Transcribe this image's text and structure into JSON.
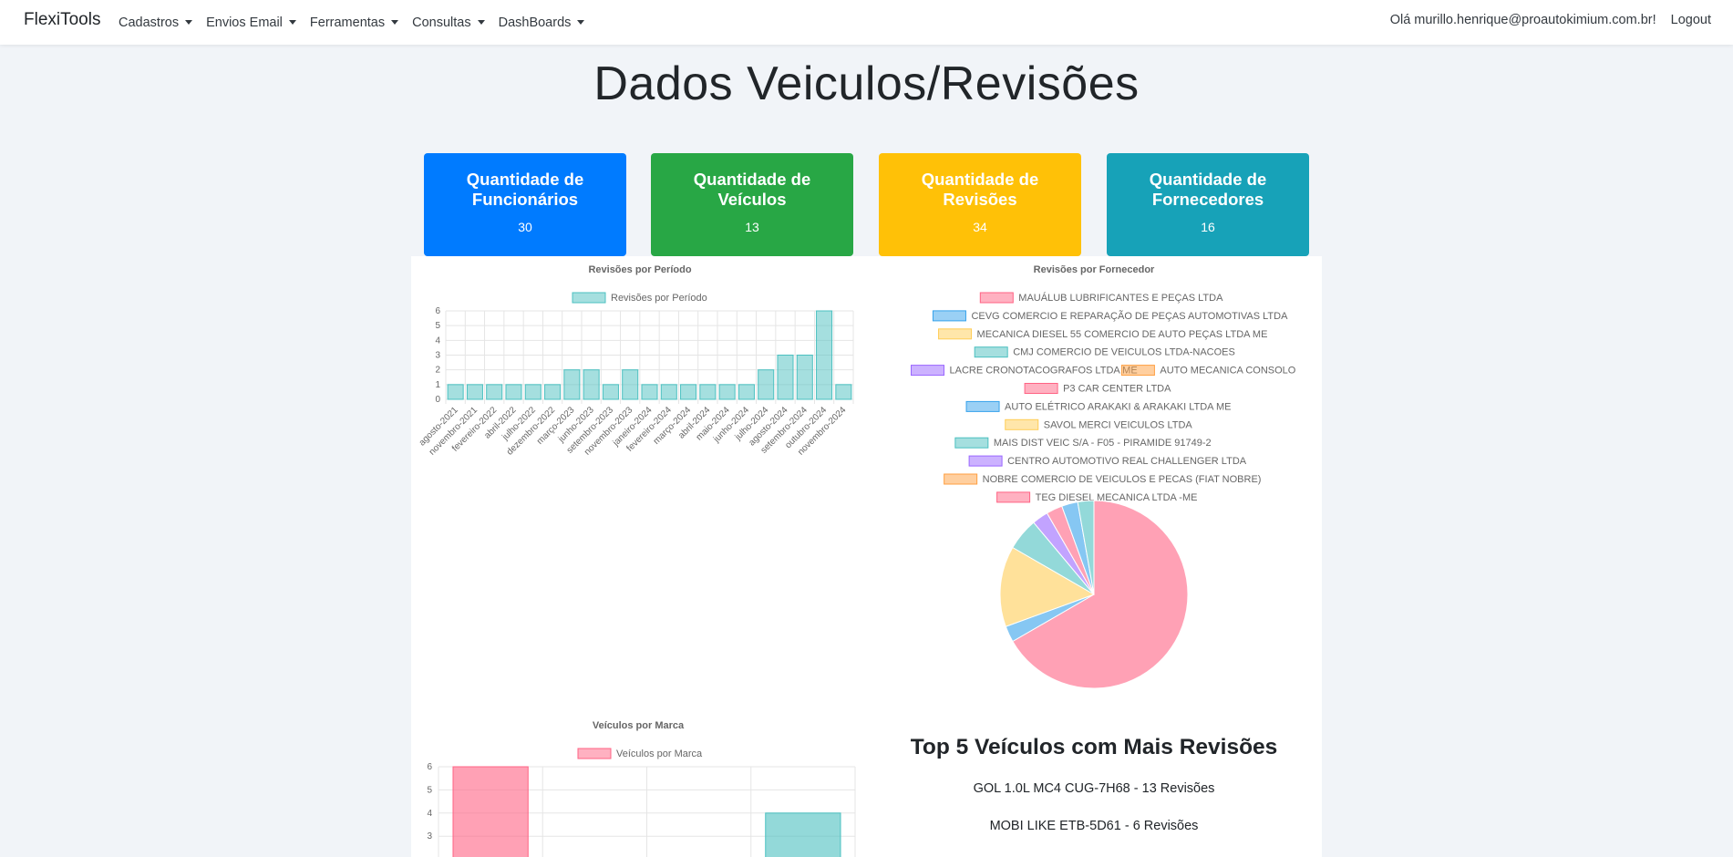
{
  "app": {
    "brand": "FlexiTools"
  },
  "nav": {
    "items": [
      {
        "label": "Cadastros"
      },
      {
        "label": "Envios Email"
      },
      {
        "label": "Ferramentas"
      },
      {
        "label": "Consultas"
      },
      {
        "label": "DashBoards"
      }
    ],
    "user_greeting": "Olá murillo.henrique@proautokimium.com.br!",
    "logout_label": "Logout"
  },
  "page": {
    "title": "Dados Veiculos/Revisões"
  },
  "cards": [
    {
      "title": "Quantidade de Funcionários",
      "value": "30",
      "color": "#007bff"
    },
    {
      "title": "Quantidade de Veículos",
      "value": "13",
      "color": "#28a745"
    },
    {
      "title": "Quantidade de Revisões",
      "value": "34",
      "color": "#ffc107"
    },
    {
      "title": "Quantidade de Fornecedores",
      "value": "16",
      "color": "#17a2b8"
    }
  ],
  "chart_data": [
    {
      "type": "bar",
      "title": "Revisões por Período",
      "legend": "top",
      "series": [
        {
          "name": "Revisões por Período",
          "color": "#4bc0c0"
        }
      ],
      "categories": [
        "agosto-2021",
        "novembro-2021",
        "fevereiro-2022",
        "abril-2022",
        "julho-2022",
        "dezembro-2022",
        "março-2023",
        "junho-2023",
        "setembro-2023",
        "novembro-2023",
        "janeiro-2024",
        "fevereiro-2024",
        "março-2024",
        "abril-2024",
        "maio-2024",
        "junho-2024",
        "julho-2024",
        "agosto-2024",
        "setembro-2024",
        "outubro-2024",
        "novembro-2024"
      ],
      "values": [
        1,
        1,
        1,
        1,
        1,
        1,
        2,
        2,
        1,
        2,
        1,
        1,
        1,
        1,
        1,
        1,
        2,
        3,
        3,
        6,
        1
      ],
      "ylim": [
        0,
        6
      ],
      "yticks": [
        0,
        1,
        2,
        3,
        4,
        5,
        6
      ],
      "grid": true
    },
    {
      "type": "pie",
      "title": "Revisões por Fornecedor",
      "legend": "top",
      "labels": [
        "MAUÁLUB LUBRIFICANTES E PEÇAS LTDA",
        "CEVG COMERCIO E REPARAÇÃO DE PEÇAS AUTOMOTIVAS LTDA",
        "MECANICA DIESEL 55 COMERCIO DE AUTO PEÇAS LTDA ME",
        "CMJ COMERCIO DE VEICULOS LTDA-NACOES",
        "LACRE CRONOTACOGRAFOS LTDA ME",
        "AUTO MECANICA CONSOLO",
        "P3 CAR CENTER LTDA",
        "AUTO ELÉTRICO ARAKAKI & ARAKAKI LTDA ME",
        "SAVOL MERCI VEICULOS LTDA",
        "MAIS DIST VEIC S/A - F05 - PIRAMIDE 91749-2",
        "CENTRO AUTOMOTIVO REAL CHALLENGER LTDA",
        "NOBRE COMERCIO DE VEICULOS E PECAS (FIAT NOBRE)",
        "TEG DIESEL MECANICA LTDA -ME"
      ],
      "values": [
        24,
        1,
        5,
        2,
        1,
        0,
        1,
        1,
        0,
        1,
        0,
        0,
        0
      ],
      "colors": [
        "#ff6384",
        "#36a2eb",
        "#ffcd56",
        "#4bc0c0",
        "#9966ff",
        "#ff9f40",
        "#ff6384",
        "#36a2eb",
        "#ffcd56",
        "#4bc0c0",
        "#9966ff",
        "#ff9f40",
        "#ff6384"
      ]
    },
    {
      "type": "bar",
      "title": "Veículos por Marca",
      "legend": "top",
      "series": [
        {
          "name": "Veículos por Marca"
        }
      ],
      "values": [
        6,
        0,
        0,
        4
      ],
      "colors": [
        "#ff6384",
        "#36a2eb",
        "#ffcd56",
        "#4bc0c0"
      ],
      "ylim": [
        0,
        6
      ],
      "yticks": [
        6,
        5,
        4,
        3
      ],
      "grid": true
    }
  ],
  "top5": {
    "title": "Top 5 Veículos com Mais Revisões",
    "items": [
      "GOL 1.0L MC4 CUG-7H68 - 13 Revisões",
      "MOBI LIKE ETB-5D61 - 6 Revisões"
    ]
  }
}
